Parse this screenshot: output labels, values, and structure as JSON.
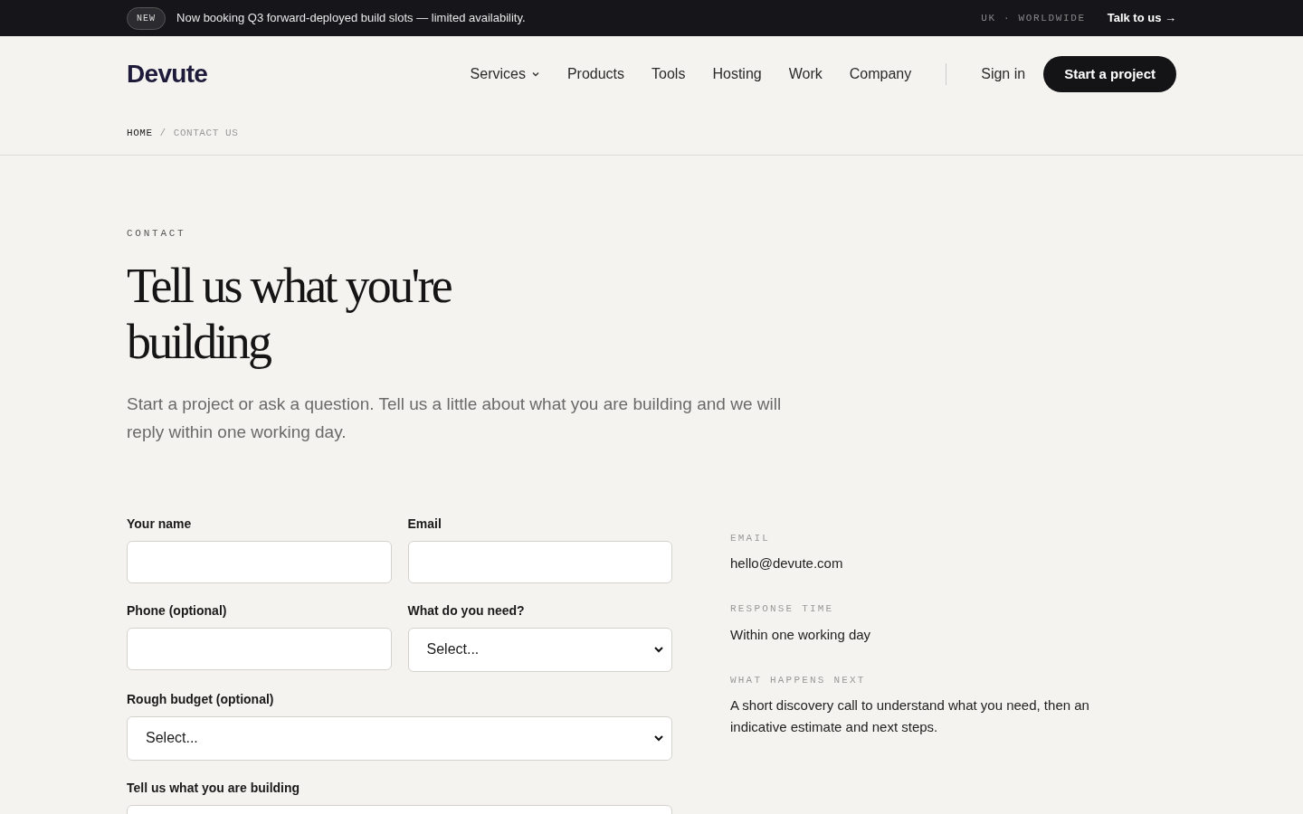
{
  "announcement": {
    "badge": "NEW",
    "text": "Now booking Q3 forward-deployed build slots — limited availability.",
    "region": "UK · WORLDWIDE",
    "link": "Talk to us →"
  },
  "header": {
    "logo": "Devute",
    "nav": [
      {
        "label": "Services",
        "has_menu": true
      },
      {
        "label": "Products",
        "has_menu": false
      },
      {
        "label": "Tools",
        "has_menu": false
      },
      {
        "label": "Hosting",
        "has_menu": false
      },
      {
        "label": "Work",
        "has_menu": false
      },
      {
        "label": "Company",
        "has_menu": false
      }
    ],
    "sign_in": "Sign in",
    "cta": "Start a project"
  },
  "breadcrumb": [
    {
      "label": "HOME",
      "selected": false
    },
    {
      "separator": "/",
      "label": "CONTACT US",
      "selected": true
    }
  ],
  "hero": {
    "eyebrow": "CONTACT",
    "title": "Tell us what you're building",
    "intro": "Start a project or ask a question. Tell us a little about what you are building and we will reply within one working day."
  },
  "form": {
    "rows": [
      [
        {
          "label": "Your name",
          "kind": "text"
        },
        {
          "label": "Email",
          "kind": "text"
        }
      ],
      [
        {
          "label": "Phone (optional)",
          "kind": "text"
        },
        {
          "label": "What do you need?",
          "kind": "select",
          "value": "Select..."
        }
      ],
      [
        {
          "label": "Rough budget (optional)",
          "kind": "select",
          "value": "Select..."
        }
      ],
      [
        {
          "label": "Tell us what you are building",
          "kind": "textarea"
        }
      ]
    ]
  },
  "details": [
    {
      "label": "EMAIL",
      "value": "hello@devute.com"
    },
    {
      "label": "RESPONSE TIME",
      "value": "Within one working day"
    },
    {
      "label": "WHAT HAPPENS NEXT",
      "value": "A short discovery call to understand what you need, then an indicative estimate and next steps."
    }
  ]
}
